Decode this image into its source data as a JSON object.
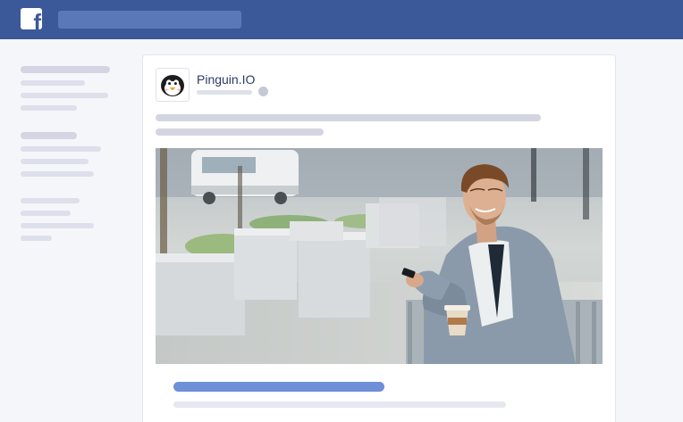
{
  "header": {
    "logo_letter": "f",
    "brand_color": "#3b5998",
    "icons": [
      "facebook-logo-icon"
    ]
  },
  "post": {
    "page_name": "Pinguin.IO",
    "avatar_icon": "penguin-icon",
    "privacy_icon": "globe-icon",
    "link_title_color": "#6f8fd8"
  },
  "photo": {
    "subject": "photo-man-with-phone-and-coffee"
  }
}
